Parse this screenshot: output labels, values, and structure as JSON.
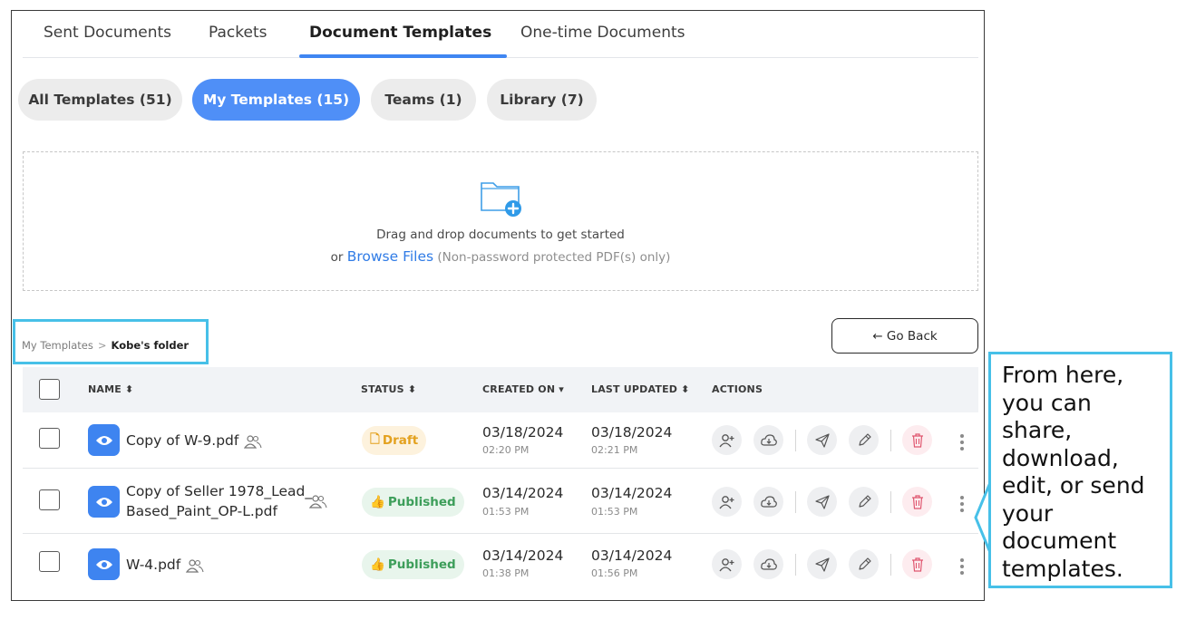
{
  "tabs": [
    {
      "label": "Sent Documents",
      "active": false
    },
    {
      "label": "Packets",
      "active": false
    },
    {
      "label": "Document Templates",
      "active": true
    },
    {
      "label": "One-time Documents",
      "active": false
    }
  ],
  "filters": [
    {
      "label": "All Templates (51)",
      "active": false
    },
    {
      "label": "My Templates (15)",
      "active": true
    },
    {
      "label": "Teams (1)",
      "active": false
    },
    {
      "label": "Library (7)",
      "active": false
    }
  ],
  "dropzone": {
    "line1": "Drag and drop documents to get started",
    "prefix": "or",
    "link": "Browse Files",
    "note": "(Non-password protected PDF(s) only)",
    "icon": "folder-plus-icon"
  },
  "breadcrumb": {
    "parent": "My Templates",
    "separator": ">",
    "current": "Kobe's folder"
  },
  "go_back": "← Go Back",
  "table": {
    "headers": {
      "name": "NAME ⬍",
      "status": "STATUS ⬍",
      "created": "CREATED ON ▾",
      "updated": "LAST UPDATED ⬍",
      "actions": "ACTIONS"
    },
    "rows": [
      {
        "name": "Copy of W-9.pdf",
        "status": "Draft",
        "created_date": "03/18/2024",
        "created_time": "02:20 PM",
        "updated_date": "03/18/2024",
        "updated_time": "02:21 PM"
      },
      {
        "name_line1": "Copy of Seller 1978_Lead_",
        "name_line2": "Based_Paint_OP-L.pdf",
        "status": "Published",
        "created_date": "03/14/2024",
        "created_time": "01:53 PM",
        "updated_date": "03/14/2024",
        "updated_time": "01:53 PM"
      },
      {
        "name": "W-4.pdf",
        "status": "Published",
        "created_date": "03/14/2024",
        "created_time": "01:38 PM",
        "updated_date": "03/14/2024",
        "updated_time": "01:56 PM"
      }
    ]
  },
  "callout": {
    "lines": [
      "From here,",
      "you can",
      "share,",
      "download,",
      "edit, or send",
      "your",
      "document",
      "templates."
    ]
  },
  "colors": {
    "accent": "#3f86f2",
    "callout_border": "#47c0e8",
    "draft": "#e3a11e",
    "published": "#3d9e5a",
    "delete": "#e0566f"
  }
}
